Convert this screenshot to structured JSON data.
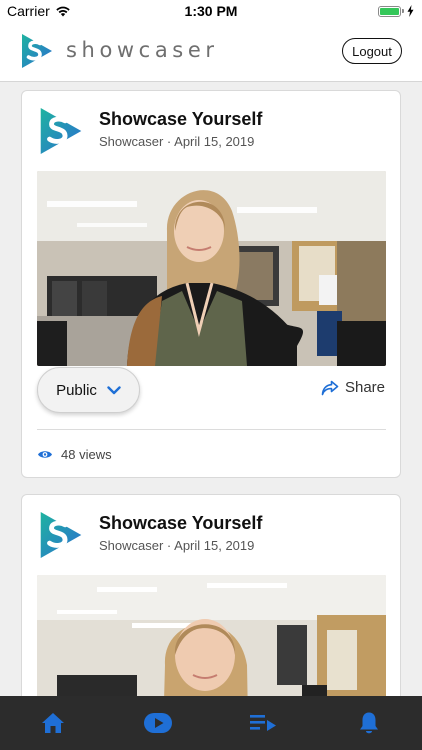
{
  "status_bar": {
    "carrier": "Carrier",
    "time": "1:30 PM",
    "battery_level": 1.0
  },
  "header": {
    "brand_name": "showcaser",
    "logout_label": "Logout"
  },
  "posts": [
    {
      "title": "Showcase Yourself",
      "meta": "Showcaser · April 15, 2019",
      "privacy_label": "Public",
      "share_label": "Share",
      "views_label": "48 views"
    },
    {
      "title": "Showcase Yourself",
      "meta": "Showcaser · April 15, 2019"
    }
  ],
  "tab_bar": {
    "items": [
      "home-icon",
      "play-icon",
      "playlist-icon",
      "bell-icon"
    ],
    "active_index": 1
  },
  "colors": {
    "accent_blue": "#1f6fd6",
    "brand_teal": "#1fa6a0",
    "brand_blue": "#2b7fd0",
    "tab_bar_bg": "#2c2c2c"
  }
}
